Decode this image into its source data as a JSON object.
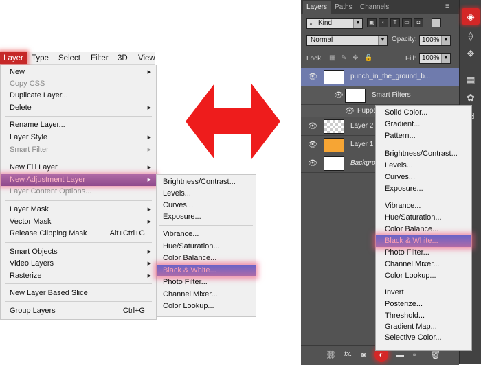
{
  "colors": {
    "menu_highlight": "#8e4a8c",
    "item_highlight": "#b06aa6",
    "arrow": "#ee1c1c",
    "ps_panel": "#535353"
  },
  "menubar": {
    "items": [
      "Layer",
      "Type",
      "Select",
      "Filter",
      "3D",
      "View"
    ]
  },
  "layer_menu": {
    "items": {
      "new": "New",
      "copy_css": "Copy CSS",
      "duplicate_layer": "Duplicate Layer...",
      "delete": "Delete",
      "rename_layer": "Rename Layer...",
      "layer_style": "Layer Style",
      "smart_filter": "Smart Filter",
      "new_fill_layer": "New Fill Layer",
      "new_adjustment_layer": "New Adjustment Layer",
      "layer_content_options": "Layer Content Options...",
      "layer_mask": "Layer Mask",
      "vector_mask": "Vector Mask",
      "release_clipping_mask": "Release Clipping Mask",
      "smart_objects": "Smart Objects",
      "video_layers": "Video Layers",
      "rasterize": "Rasterize",
      "new_layer_based_slice": "New Layer Based Slice",
      "group_layers": "Group Layers"
    },
    "shortcuts": {
      "release_clipping_mask": "Alt+Ctrl+G",
      "group_layers": "Ctrl+G"
    }
  },
  "adjustment_submenu": {
    "items": [
      "Brightness/Contrast...",
      "Levels...",
      "Curves...",
      "Exposure...",
      "Vibrance...",
      "Hue/Saturation...",
      "Color Balance...",
      "Black & White...",
      "Photo Filter...",
      "Channel Mixer...",
      "Color Lookup..."
    ],
    "selected": "Black & White..."
  },
  "layers_panel": {
    "tabs": [
      "Layers",
      "Paths",
      "Channels"
    ],
    "filter_kind": "Kind",
    "blend_mode": "Normal",
    "opacity_label": "Opacity:",
    "opacity_value": "100%",
    "lock_label": "Lock:",
    "fill_label": "Fill:",
    "fill_value": "100%",
    "layers": {
      "main": "punch_in_the_ground_b...",
      "smart_filters": "Smart Filters",
      "puppet": "Puppe",
      "layer2": "Layer 2",
      "layer1": "Layer 1",
      "background": "Backgro"
    }
  },
  "adjustment_dropdown": {
    "items": [
      "Solid Color...",
      "Gradient...",
      "Pattern...",
      "Brightness/Contrast...",
      "Levels...",
      "Curves...",
      "Exposure...",
      "Vibrance...",
      "Hue/Saturation...",
      "Color Balance...",
      "Black & White...",
      "Photo Filter...",
      "Channel Mixer...",
      "Color Lookup...",
      "Invert",
      "Posterize...",
      "Threshold...",
      "Gradient Map...",
      "Selective Color..."
    ],
    "selected": "Black & White..."
  },
  "panel_bottom": {
    "fx_label": "fx."
  }
}
